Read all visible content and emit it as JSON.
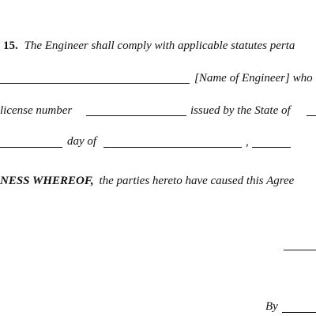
{
  "clause": {
    "number": "15.",
    "text": "The Engineer shall comply with applicable statutes perta"
  },
  "name_line": {
    "suffix": "[Name of Engineer] who"
  },
  "license_line": {
    "prefix": "license number",
    "middle": "issued by the State of"
  },
  "date_line": {
    "day_of": "day of",
    "comma": ","
  },
  "witness": {
    "lead": "NESS  WHEREOF,",
    "text": "the parties hereto have caused this Agree"
  },
  "signature": {
    "by_label": "By"
  }
}
